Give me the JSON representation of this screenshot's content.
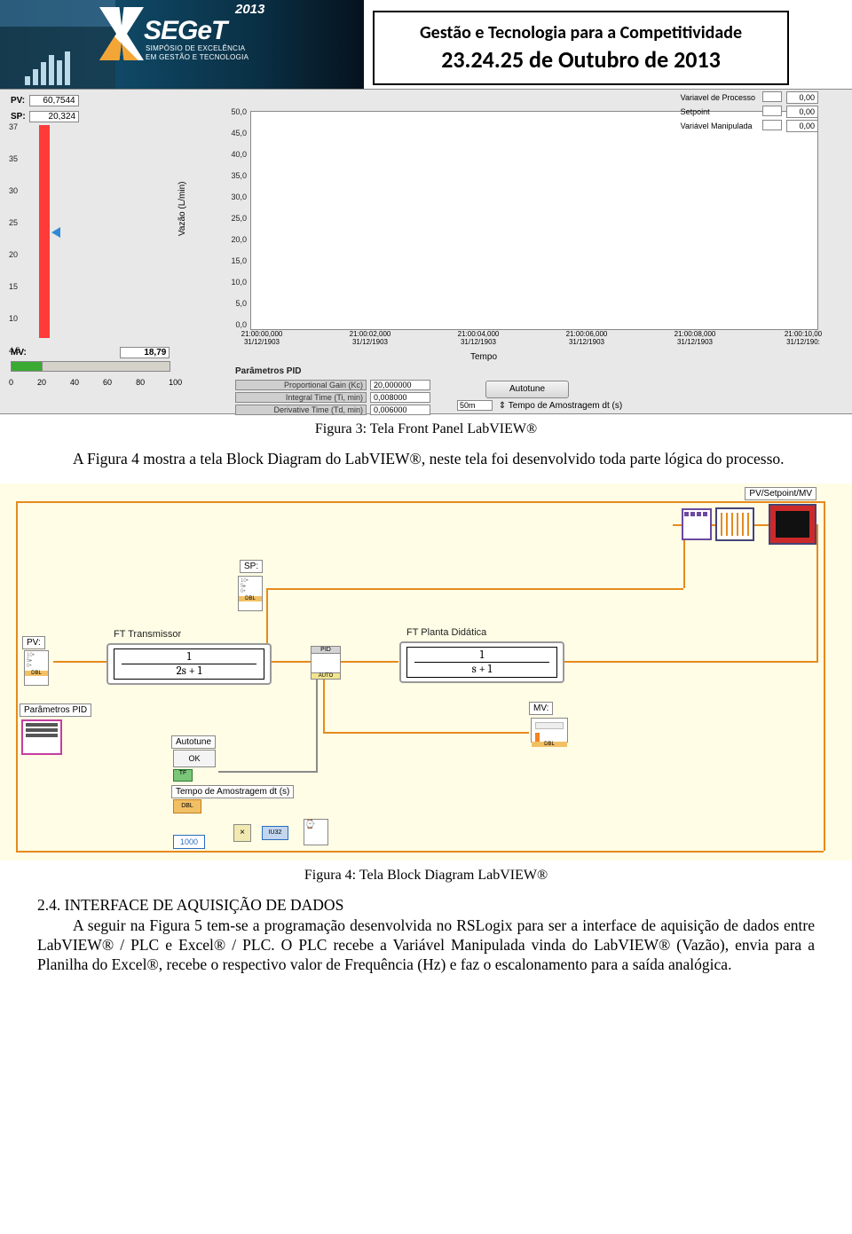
{
  "header": {
    "year": "2013",
    "brand": "SEGeT",
    "brand_sub1": "SIMPÓSIO DE EXCELÊNCIA",
    "brand_sub2": "EM GESTÃO E TECNOLOGIA",
    "title": "Gestão e Tecnologia para a Competitividade",
    "dates": "23.24.25 de Outubro de 2013"
  },
  "frontpanel": {
    "pv_label": "PV:",
    "pv_value": "60,7544",
    "sp_label": "SP:",
    "sp_value": "20,324",
    "left_scale": [
      "37",
      "35",
      "30",
      "25",
      "20",
      "15",
      "10",
      "4,5"
    ],
    "mv_label": "MV:",
    "mv_value": "18,79",
    "mv_scale": [
      "0",
      "20",
      "40",
      "60",
      "80",
      "100"
    ],
    "y_axis_label": "Vazão (L/min)",
    "y_scale": [
      "50,0",
      "45,0",
      "40,0",
      "35,0",
      "30,0",
      "25,0",
      "20,0",
      "15,0",
      "10,0",
      "5,0",
      "0,0"
    ],
    "x_axis_label": "Tempo",
    "x_ticks": [
      {
        "t": "21:00:00,000",
        "d": "31/12/1903"
      },
      {
        "t": "21:00:02,000",
        "d": "31/12/1903"
      },
      {
        "t": "21:00:04,000",
        "d": "31/12/1903"
      },
      {
        "t": "21:00:06,000",
        "d": "31/12/1903"
      },
      {
        "t": "21:00:08,000",
        "d": "31/12/1903"
      },
      {
        "t": "21:00:10,00",
        "d": "31/12/190:"
      }
    ],
    "legend": [
      {
        "name": "Variavel de Processo",
        "value": "0,00"
      },
      {
        "name": "Setpoint",
        "value": "0,00"
      },
      {
        "name": "Variável Manipulada",
        "value": "0,00"
      }
    ],
    "pid_title": "Parâmetros PID",
    "pid_rows": [
      {
        "name": "Proportional Gain (Kc)",
        "val": "20,000000"
      },
      {
        "name": "Integral Time (Ti, min)",
        "val": "0,008000"
      },
      {
        "name": "Derivative Time (Td, min)",
        "val": "0,006000"
      }
    ],
    "autotune": "Autotune",
    "sample_value": "50m",
    "sample_label": "Tempo de Amostragem dt (s)"
  },
  "captions": {
    "fig3": "Figura 3: Tela Front Panel LabVIEW®",
    "fig4": "Figura 4: Tela Block Diagram LabVIEW®"
  },
  "paragraphs": {
    "p1": "A Figura 4 mostra a tela Block Diagram do LabVIEW®, neste tela foi desenvolvido toda parte lógica do processo.",
    "p2_head": "2.4. INTERFACE DE AQUISIÇÃO DE DADOS",
    "p2": "A seguir na Figura 5 tem-se a programação desenvolvida no RSLogix para ser a interface de aquisição de dados entre LabVIEW® / PLC e Excel® / PLC. O PLC recebe a Variável Manipulada vinda do LabVIEW® (Vazão), envia para a Planilha do Excel®, recebe o respectivo valor de Frequência (Hz) e faz o escalonamento para a saída analógica."
  },
  "blockdiagram": {
    "sp_label": "SP:",
    "pv_label": "PV:",
    "tf1_title": "FT Transmissor",
    "tf1_num": "1",
    "tf1_den": "2s + 1",
    "tf2_title": "FT Planta Didática",
    "tf2_num": "1",
    "tf2_den": "s + 1",
    "mv_label": "MV:",
    "param_label": "Parâmetros PID",
    "autotune_label": "Autotune",
    "ok": "OK",
    "tf_flag": "TF",
    "amost_label": "Tempo de Amostragem dt (s)",
    "dbl": "DBL",
    "k1000": "1000",
    "iu32": "IU32",
    "top_label": "PV/Setpoint/MV",
    "pid_auto": "AUTO"
  }
}
